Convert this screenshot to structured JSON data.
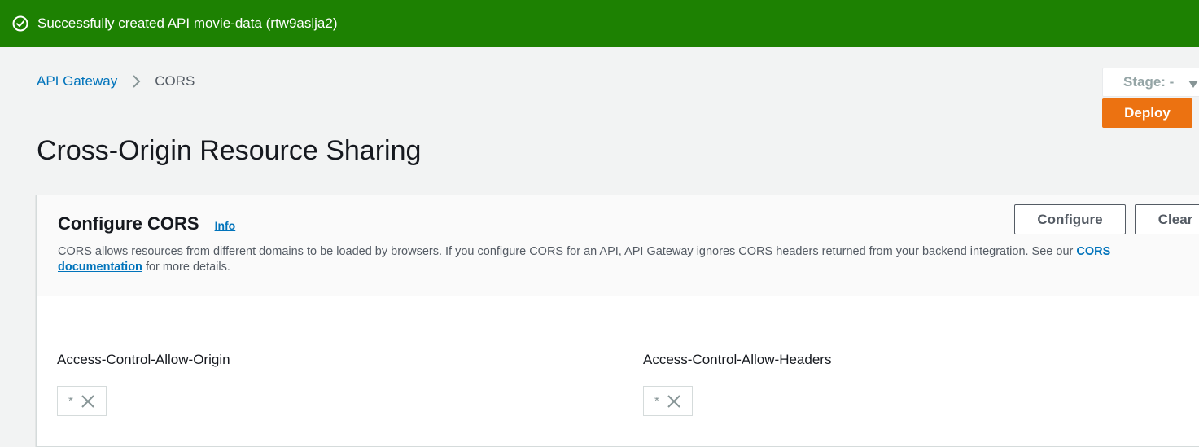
{
  "flash": {
    "message": "Successfully created API movie-data (rtw9aslja2)",
    "color": "#1d8102",
    "icon": "check-circle-icon"
  },
  "breadcrumb": {
    "items": [
      {
        "label": "API Gateway"
      },
      {
        "label": "CORS"
      }
    ],
    "separator_icon": "chevron-right-icon"
  },
  "header": {
    "stage_select": {
      "value": "Stage: -",
      "icon": "caret-down-icon"
    },
    "deploy_label": "Deploy",
    "deploy_color": "#ec7211"
  },
  "page": {
    "title": "Cross-Origin Resource Sharing"
  },
  "panel": {
    "title": "Configure CORS",
    "info_link": "Info",
    "description_prefix": "CORS allows resources from different domains to be loaded by browsers. If you configure CORS for an API, API Gateway ignores CORS headers returned from your backend integration. See our ",
    "doc_link_line1": "CORS",
    "doc_link_line2": "documentation",
    "description_suffix": " for more details.",
    "configure_label": "Configure",
    "clear_label": "Clear"
  },
  "fields": {
    "allow_origin": {
      "label": "Access-Control-Allow-Origin",
      "tokens": [
        "*"
      ]
    },
    "allow_headers": {
      "label": "Access-Control-Allow-Headers",
      "tokens": [
        "*"
      ]
    }
  },
  "colors": {
    "link": "#0073bb",
    "background": "#f2f3f3"
  }
}
